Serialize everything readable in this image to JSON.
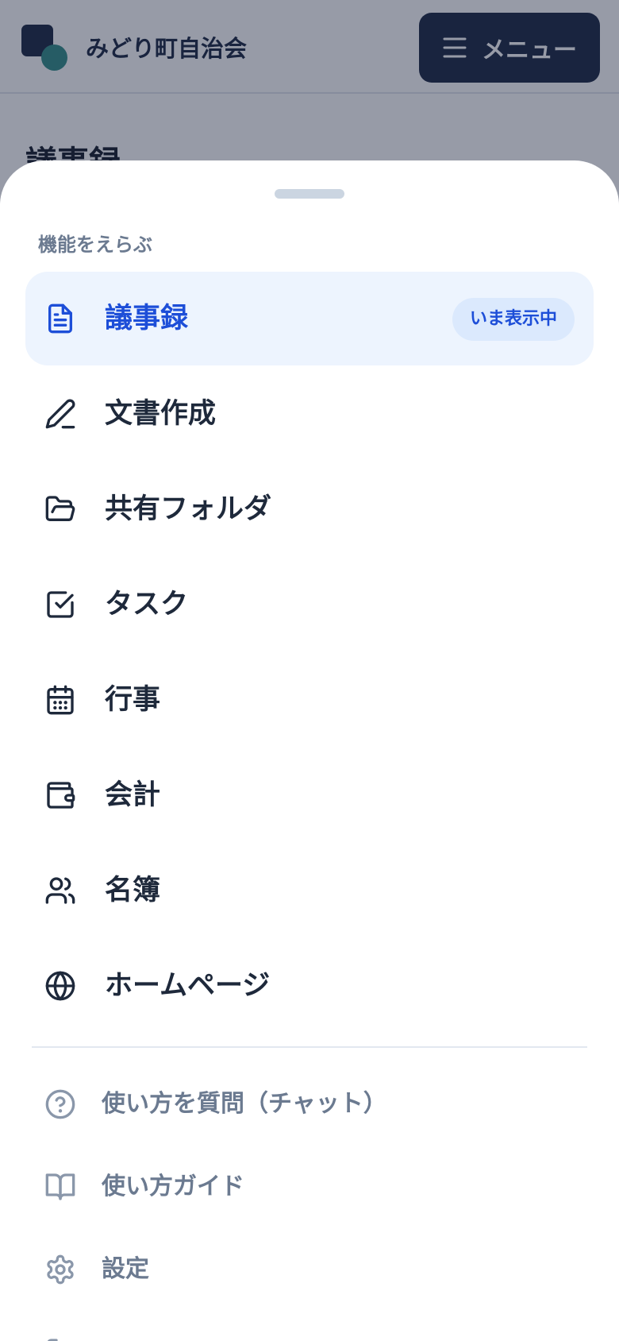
{
  "header": {
    "org_name": "みどり町自治会",
    "logo_icon": "community-logo-icon",
    "menu_button_label": "メニュー",
    "menu_icon": "hamburger-menu-icon"
  },
  "page": {
    "title": "議事録"
  },
  "sheet": {
    "section_label": "機能をえらぶ",
    "items": [
      {
        "label": "議事録",
        "icon": "document-icon",
        "active": true,
        "badge": "いま表示中"
      },
      {
        "label": "文書作成",
        "icon": "pen-icon",
        "active": false
      },
      {
        "label": "共有フォルダ",
        "icon": "folder-open-icon",
        "active": false
      },
      {
        "label": "タスク",
        "icon": "checkbox-icon",
        "active": false
      },
      {
        "label": "行事",
        "icon": "calendar-icon",
        "active": false
      },
      {
        "label": "会計",
        "icon": "wallet-icon",
        "active": false
      },
      {
        "label": "名簿",
        "icon": "users-icon",
        "active": false
      },
      {
        "label": "ホームページ",
        "icon": "globe-icon",
        "active": false
      }
    ],
    "secondary": [
      {
        "label": "使い方を質問（チャット）",
        "icon": "help-circle-icon"
      },
      {
        "label": "使い方ガイド",
        "icon": "book-open-icon"
      },
      {
        "label": "設定",
        "icon": "gear-icon"
      }
    ]
  },
  "colors": {
    "navy": "#17233f",
    "teal": "#2f8b86",
    "active_blue": "#1d4ed8",
    "active_bg": "#edf4fe",
    "badge_bg": "#dbe9fd",
    "muted_text": "#6b7a90",
    "text": "#1e293b",
    "overlay": "rgba(28,38,64,0.46)"
  }
}
